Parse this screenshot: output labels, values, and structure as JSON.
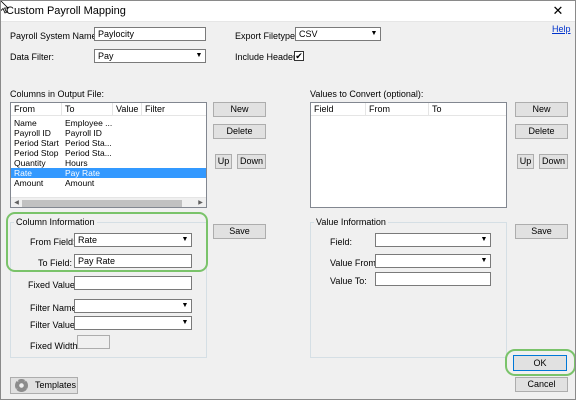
{
  "window": {
    "title": "Custom Payroll Mapping",
    "close_glyph": "✕"
  },
  "help_link": "Help",
  "top_form": {
    "system_name_label": "Payroll System Name:",
    "system_name_value": "Paylocity",
    "data_filter_label": "Data Filter:",
    "data_filter_value": "Pay",
    "export_filetype_label": "Export Filetype:",
    "export_filetype_value": "CSV",
    "include_header_label": "Include Header",
    "include_header_checked": "✔"
  },
  "columns_panel": {
    "label": "Columns in Output File:",
    "headers": [
      "From",
      "To",
      "Value",
      "Filter"
    ],
    "rows": [
      {
        "from": "Name",
        "to": "Employee ..."
      },
      {
        "from": "Payroll ID",
        "to": "Payroll ID"
      },
      {
        "from": "Period Start",
        "to": "Period Sta..."
      },
      {
        "from": "Period Stop",
        "to": "Period Sta..."
      },
      {
        "from": "Quantity",
        "to": "Hours"
      },
      {
        "from": "Rate",
        "to": "Pay Rate"
      },
      {
        "from": "Amount",
        "to": "Amount"
      }
    ],
    "selected_index": 5,
    "new_label": "New",
    "delete_label": "Delete",
    "up_label": "Up",
    "down_label": "Down"
  },
  "values_panel": {
    "label": "Values to Convert (optional):",
    "headers": [
      "Field",
      "From",
      "To"
    ],
    "new_label": "New",
    "delete_label": "Delete",
    "up_label": "Up",
    "down_label": "Down"
  },
  "column_info": {
    "title": "Column Information",
    "from_field_label": "From Field:",
    "from_field_value": "Rate",
    "to_field_label": "To Field:",
    "to_field_value": "Pay Rate",
    "fixed_value_label": "Fixed Value:",
    "fixed_value_value": "",
    "filter_name_label": "Filter Name:",
    "filter_name_value": "",
    "filter_value_label": "Filter Value:",
    "filter_value_value": "",
    "fixed_width_label": "Fixed Width:",
    "save_label": "Save"
  },
  "value_info": {
    "title": "Value Information",
    "field_label": "Field:",
    "field_value": "",
    "value_from_label": "Value From:",
    "value_from_value": "",
    "value_to_label": "Value To:",
    "value_to_value": "",
    "save_label": "Save"
  },
  "footer": {
    "templates_label": "Templates",
    "ok_label": "OK",
    "cancel_label": "Cancel"
  },
  "icons": {
    "dropdown": "▼",
    "scroll_left": "◀",
    "scroll_right": "▶",
    "gear": "gear-icon",
    "cursor": "mouse-pointer-icon"
  },
  "colors": {
    "selection": "#3399ff",
    "highlight_ring": "#7ac36a",
    "link": "#0033cc"
  }
}
